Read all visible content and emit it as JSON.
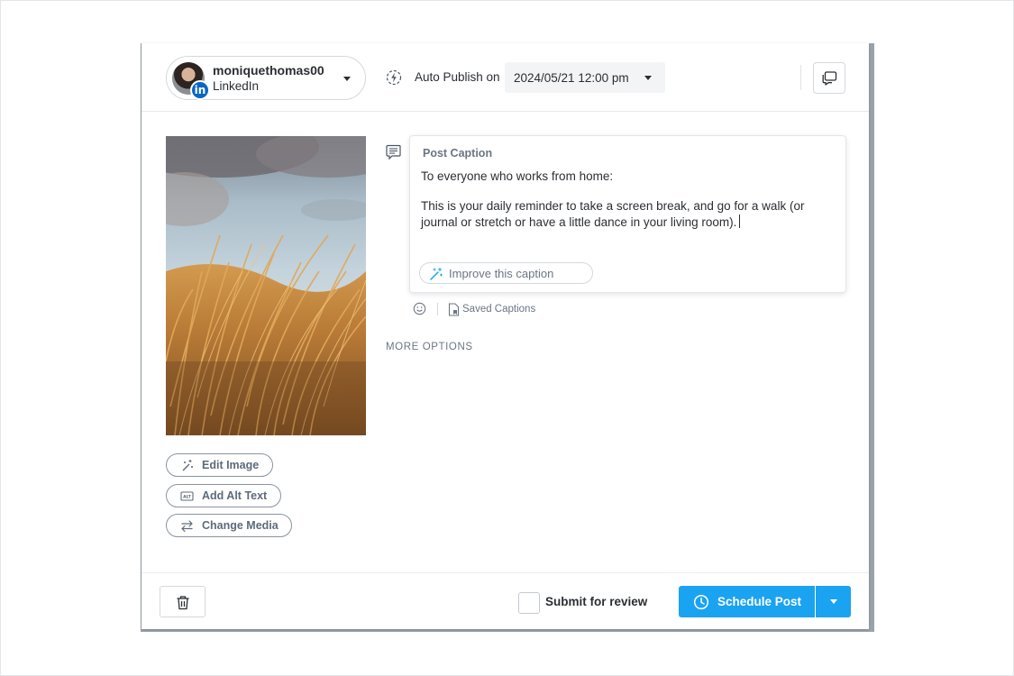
{
  "header": {
    "account": {
      "name": "moniquethomas00",
      "network": "LinkedIn",
      "network_badge": "in",
      "badge_color": "#0a66c2"
    },
    "auto_publish_label": "Auto Publish on",
    "publish_datetime": "2024/05/21 12:00 pm"
  },
  "media": {
    "edit_image_label": "Edit Image",
    "add_alt_text_label": "Add Alt Text",
    "change_media_label": "Change Media",
    "alt_icon_text": "ALT"
  },
  "caption": {
    "label": "Post Caption",
    "text": "To everyone who works from home:\n\nThis is your daily reminder to take a screen break, and go for a walk (or journal or stretch or have a little dance in your living room).",
    "improve_label": "Improve this caption",
    "saved_captions_label": "Saved Captions"
  },
  "more_options_label": "MORE OPTIONS",
  "footer": {
    "submit_review_label": "Submit for review",
    "submit_review_checked": false,
    "schedule_label": "Schedule Post",
    "accent_color": "#1aa3f0"
  }
}
